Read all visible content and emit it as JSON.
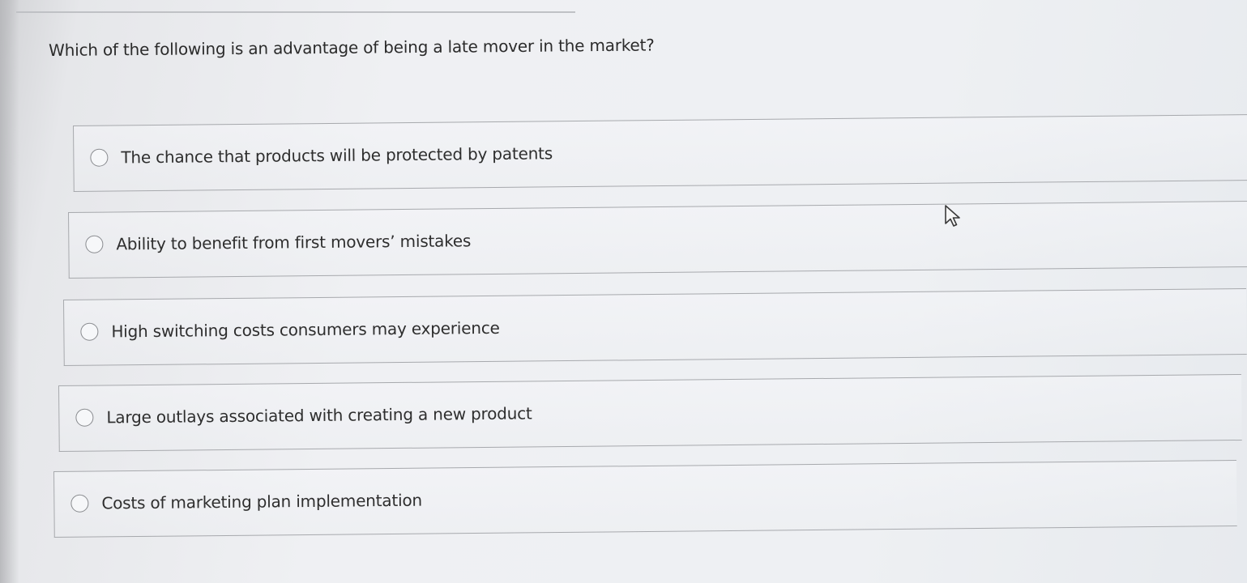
{
  "question": {
    "text": "Which of the following is an advantage of being a late mover in the market?"
  },
  "options": [
    {
      "label": "The chance that products will be protected by patents",
      "selected": false
    },
    {
      "label": "Ability to benefit from first movers’ mistakes",
      "selected": false
    },
    {
      "label": "High switching costs consumers may experience",
      "selected": false
    },
    {
      "label": "Large outlays associated with creating a new product",
      "selected": false
    },
    {
      "label": "Costs of marketing plan implementation",
      "selected": false
    }
  ],
  "icons": {
    "radio": "radio-unchecked-icon",
    "cursor": "mouse-pointer-icon"
  }
}
